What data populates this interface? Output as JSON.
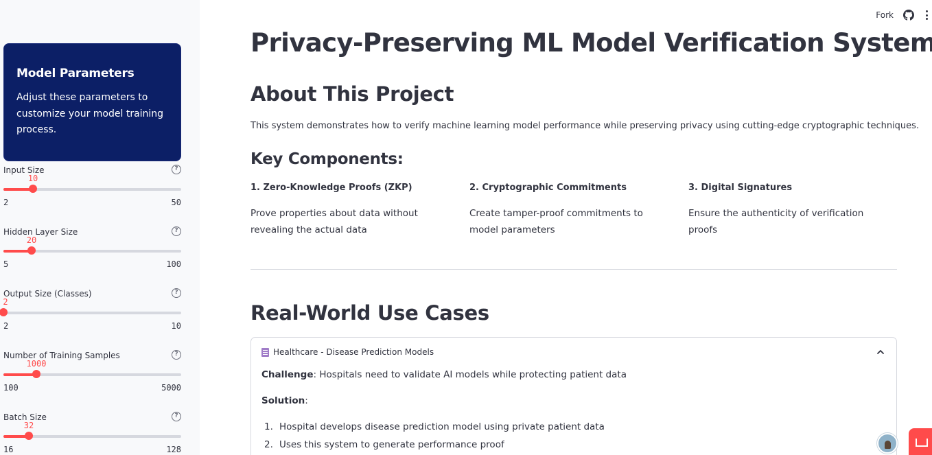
{
  "topbar": {
    "fork_label": "Fork"
  },
  "sidebar": {
    "card": {
      "title": "Model Parameters",
      "description": "Adjust these parameters to customize your model training process."
    },
    "sliders": [
      {
        "label": "Input Size",
        "value": "10",
        "min": "2",
        "max": "50",
        "fraction": 0.1667
      },
      {
        "label": "Hidden Layer Size",
        "value": "20",
        "min": "5",
        "max": "100",
        "fraction": 0.158
      },
      {
        "label": "Output Size (Classes)",
        "value": "2",
        "min": "2",
        "max": "10",
        "fraction": 0.0
      },
      {
        "label": "Number of Training Samples",
        "value": "1000",
        "min": "100",
        "max": "5000",
        "fraction": 0.1837
      },
      {
        "label": "Batch Size",
        "value": "32",
        "min": "16",
        "max": "128",
        "fraction": 0.1429
      }
    ]
  },
  "main": {
    "title": "Privacy-Preserving ML Model Verification System",
    "about_heading": "About This Project",
    "about_text": "This system demonstrates how to verify machine learning model performance while preserving privacy using cutting-edge cryptographic techniques.",
    "components_heading": "Key Components:",
    "components": [
      {
        "title": "1. Zero-Knowledge Proofs (ZKP)",
        "desc": "Prove properties about data without revealing the actual data"
      },
      {
        "title": "2. Cryptographic Commitments",
        "desc": "Create tamper-proof commitments to model parameters"
      },
      {
        "title": "3. Digital Signatures",
        "desc": "Ensure the authenticity of verification proofs"
      }
    ],
    "use_cases_heading": "Real-World Use Cases",
    "expander": {
      "title": "Healthcare - Disease Prediction Models",
      "challenge_label": "Challenge",
      "challenge_text": ": Hospitals need to validate AI models while protecting patient data",
      "solution_label": "Solution",
      "solution_suffix": ":",
      "steps": [
        {
          "num": "1.",
          "text": "Hospital develops disease prediction model using private patient data"
        },
        {
          "num": "2.",
          "text": "Uses this system to generate performance proof"
        }
      ]
    }
  },
  "colors": {
    "accent": "#ff4b4b",
    "card_bg": "#0c1f66",
    "sidebar_bg": "#f8f9fb",
    "text": "#31333f"
  },
  "icons": [
    "help-circle-icon",
    "github-icon",
    "more-vertical-icon",
    "memo-icon",
    "chevron-up-icon"
  ]
}
